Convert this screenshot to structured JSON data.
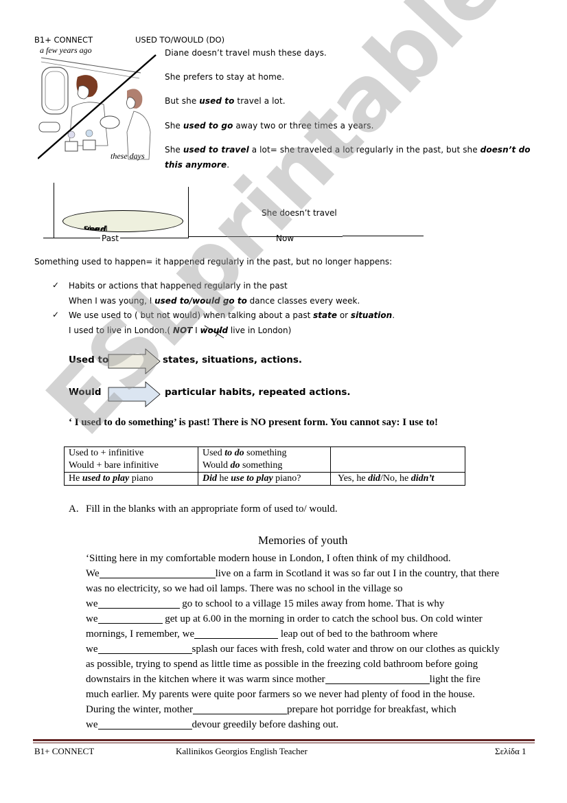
{
  "header": {
    "course": "B1+ CONNECT",
    "topic": "USED TO/WOULD (DO)"
  },
  "illustration": {
    "caption_top": "a few years ago",
    "caption_bottom": "these days"
  },
  "intro": {
    "line1": "Diane doesn’t travel mush these days.",
    "line2": "She prefers to stay at home.",
    "line3_pre": "But she ",
    "line3_em": "used to",
    "line3_post": " travel a lot.",
    "line4_pre": "She ",
    "line4_em": "used to go",
    "line4_post": "  away two or three times a years.",
    "line5_pre": "She ",
    "line5_em": "used to travel",
    "line5_mid": "  a lot= she traveled a lot regularly in the past, but she ",
    "line5_em2": "doesn’t do",
    "line6_em": "this anymore",
    "line6_post": "."
  },
  "timeline": {
    "ellipse_pre": "She ",
    "ellipse_em": "used to",
    "ellipse_post": " travel",
    "now_text": "She doesn’t travel",
    "past_label": "Past",
    "now_label": "Now"
  },
  "definition": "Something used to happen= it happened regularly in the past, but no longer happens:",
  "checks": [
    {
      "icon": "checkmark",
      "title": "Habits or actions that happened regularly in the past",
      "example_pre": "When I was young, I ",
      "example_em": "used to/would go to",
      "example_post": " dance classes every week."
    },
    {
      "icon": "checkmark",
      "title_pre": "We use used to ( but not would) when talking about a past ",
      "title_em1": "state",
      "title_mid": " or ",
      "title_em2": "situation",
      "title_post": ".",
      "example_pre": "I used to live in London.( ",
      "example_em": "NOT",
      "example_mid": " I ",
      "example_struck": "would",
      "example_post": " live in London)"
    }
  ],
  "arrows": [
    {
      "label": "Used to",
      "text": "states, situations, actions.",
      "fill": "#eeece1"
    },
    {
      "label": "Would",
      "text": "particular habits, repeated actions.",
      "fill": "#dbe5f1"
    }
  ],
  "note": "‘ I used to do something’ is past! There is NO present form. You cannot say: I use to!",
  "table": {
    "r1c1_l1": "Used to + infinitive",
    "r1c1_l2": "Would + bare infinitive",
    "r1c2_l1_pre": "Used ",
    "r1c2_l1_em": "to do",
    "r1c2_l1_post": " something",
    "r1c2_l2_pre": "Would ",
    "r1c2_l2_em": "do",
    "r1c2_l2_post": " something",
    "r1c3": "",
    "r2c1_pre": "He ",
    "r2c1_em": "used to play",
    "r2c1_post": " piano",
    "r2c2_em1": "Did",
    "r2c2_mid": " he ",
    "r2c2_em2": "use to play",
    "r2c2_post": " piano?",
    "r2c3_pre": "Yes, he ",
    "r2c3_em1": "did",
    "r2c3_mid": "/No, he ",
    "r2c3_em2": "didn’t"
  },
  "exercise": {
    "marker": "A.",
    "instruction": "Fill in the blanks with an appropriate form of used to/ would.",
    "title": "Memories of youth",
    "lines": [
      {
        "pre": "‘Sitting here in my comfortable modern house in London, I often think of my childhood.",
        "post": ""
      },
      {
        "pre": "We",
        "post": "live on a farm in Scotland it was so far out I in the country, that there"
      },
      {
        "pre": "was no electricity, so we had oil lamps. There was no school in the village so",
        "post": ""
      },
      {
        "pre": "we",
        "post": " go to school to a village 15 miles away from home. That is why"
      },
      {
        "pre": "we",
        "post": " get up at 6.00 in the morning in order to catch the school bus. On cold winter"
      },
      {
        "pre": "mornings, I remember, we",
        "post": " leap out of bed to the bathroom where"
      },
      {
        "pre": "we",
        "post": "splash our faces with fresh, cold water and throw on our clothes as quickly"
      },
      {
        "pre": "as possible, trying to spend as little time as possible in the freezing cold bathroom before going",
        "post": ""
      },
      {
        "pre": "downstairs in the kitchen where it was warm since mother",
        "post": "light the fire"
      },
      {
        "pre": "much earlier. My parents were quite poor farmers so we never had plenty of food in the house.",
        "post": ""
      },
      {
        "pre": "During the winter, mother",
        "post": "prepare hot porridge for breakfast, which"
      },
      {
        "pre": "we",
        "post": "devour greedily before dashing out."
      }
    ]
  },
  "footer": {
    "left": "B1+ CONNECT",
    "center": "Kallinikos Georgios   English Teacher",
    "right": "Σελίδα 1",
    "rule_color": "#622423"
  },
  "watermark": "ESLprintables.com"
}
